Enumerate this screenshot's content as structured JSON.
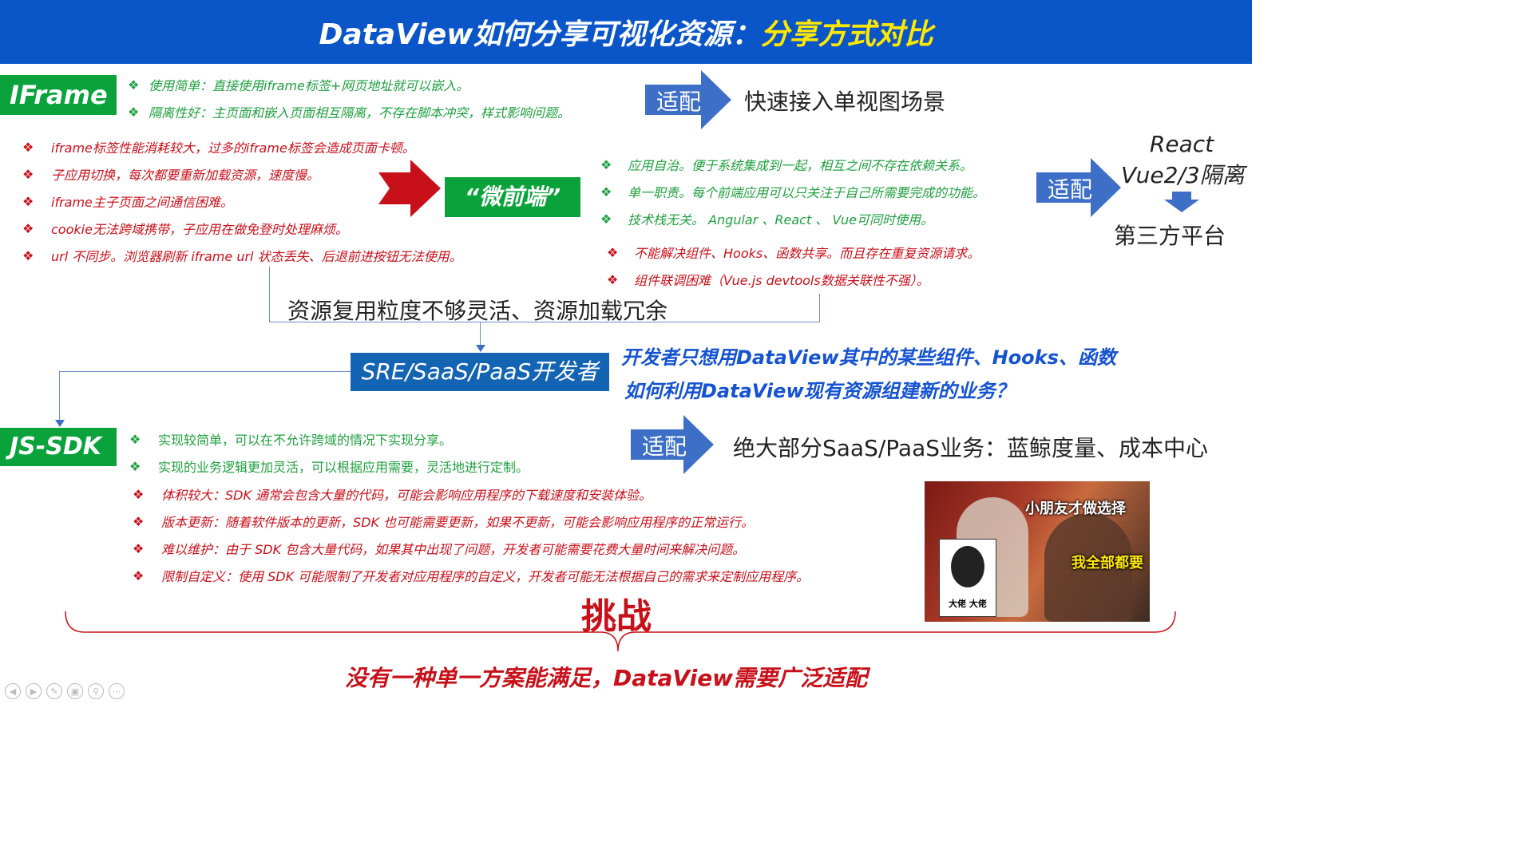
{
  "title": {
    "main": "DataView如何分享可视化资源：",
    "highlight": "分享方式对比"
  },
  "iframe": {
    "tag": "IFrame",
    "pros": [
      "使用简单：直接使用iframe标签+网页地址就可以嵌入。",
      "隔离性好：主页面和嵌入页面相互隔离，不存在脚本冲突，样式影响问题。"
    ],
    "fit_label": "适配",
    "fit_text": "快速接入单视图场景",
    "cons": [
      "iframe标签性能消耗较大，过多的iframe标签会造成页面卡顿。",
      "子应用切换，每次都要重新加载资源，速度慢。",
      "iframe主子页面之间通信困难。",
      "cookie无法跨域携带，子应用在做免登时处理麻烦。",
      "url 不同步。浏览器刷新 iframe url 状态丢失、后退前进按钮无法使用。"
    ]
  },
  "micro": {
    "tag": "“微前端”",
    "pros": [
      "应用自治。便于系统集成到一起，相互之间不存在依赖关系。",
      "单一职责。每个前端应用可以只关注于自己所需要完成的功能。",
      "技术栈无关。 Angular 、React 、 Vue可同时使用。"
    ],
    "cons": [
      "不能解决组件、Hooks、函数共享。而且存在重复资源请求。",
      "组件联调困难（Vue.js devtools数据关联性不强）。"
    ],
    "fit_label": "适配",
    "fit_line1": "React",
    "fit_line2": "Vue2/3隔离",
    "fit_line3": "第三方平台"
  },
  "reuse_issue": "资源复用粒度不够灵活、资源加载冗余",
  "dev_box": "SRE/SaaS/PaaS开发者",
  "dev_q1": "开发者只想用DataView其中的某些组件、Hooks、函数",
  "dev_q2": "如何利用DataView现有资源组建新的业务？",
  "sdk": {
    "tag": "JS-SDK",
    "pros": [
      "实现较简单，可以在不允许跨域的情况下实现分享。",
      "实现的业务逻辑更加灵活，可以根据应用需要，灵活地进行定制。"
    ],
    "fit_label": "适配",
    "fit_text": "绝大部分SaaS/PaaS业务：蓝鲸度量、成本中心",
    "cons": [
      "体积较大：SDK 通常会包含大量的代码，可能会影响应用程序的下载速度和安装体验。",
      "版本更新：随着软件版本的更新，SDK 也可能需要更新，如果不更新，可能会影响应用程序的正常运行。",
      "难以维护：由于 SDK 包含大量代码，如果其中出现了问题，开发者可能需要花费大量时间来解决问题。",
      "限制自定义：使用 SDK 可能限制了开发者对应用程序的自定义，开发者可能无法根据自己的需求来定制应用程序。"
    ]
  },
  "meme": {
    "caption1": "小朋友才做选择",
    "caption2": "我全部都要",
    "sticker": "大佬 大佬"
  },
  "challenge": "挑战",
  "conclusion": "没有一种单一方案能满足，DataView需要广泛适配",
  "bullet": "❖",
  "colors": {
    "banner": "#0a56c9",
    "green": "#0aa23a",
    "red": "#c8101a",
    "blue_arrow": "#3d6fc7",
    "dev_box": "#1464b4",
    "question": "#1553d0"
  }
}
